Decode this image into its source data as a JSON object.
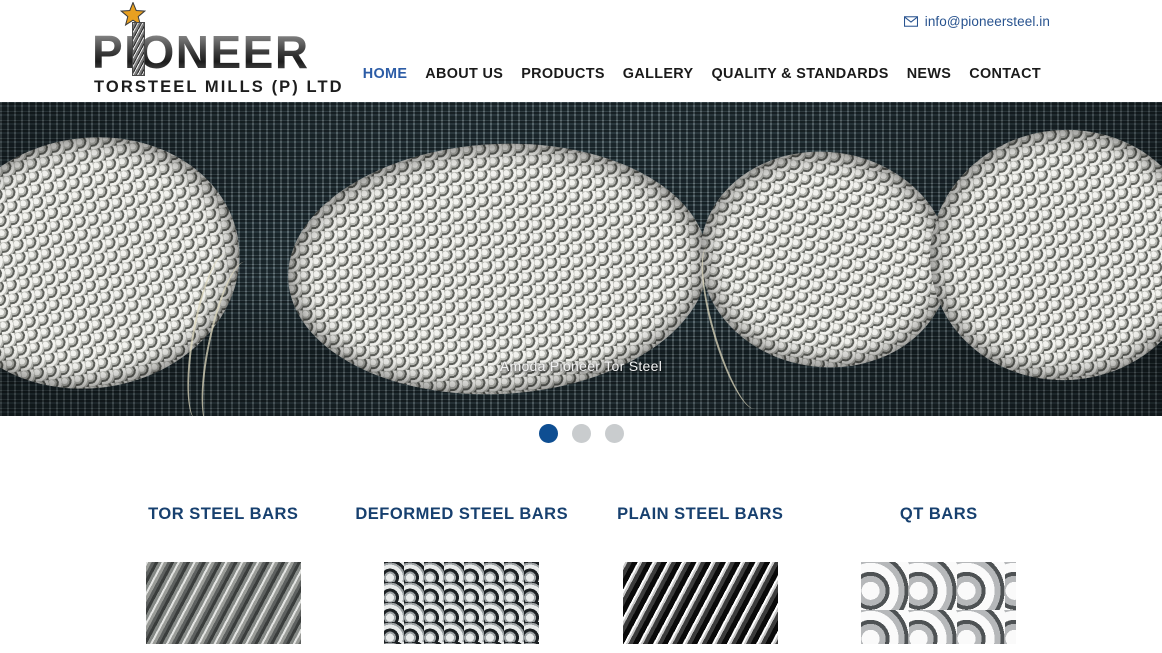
{
  "site": {
    "logo": {
      "word": "PIONEER",
      "subtitle": "TORSTEEL MILLS (P) LTD",
      "star_color": "#e8a020"
    },
    "contact": {
      "email": "info@pioneersteel.in",
      "email_color": "#28538f"
    }
  },
  "nav": {
    "items": [
      {
        "label": "HOME",
        "active": true
      },
      {
        "label": "ABOUT US",
        "active": false
      },
      {
        "label": "PRODUCTS",
        "active": false
      },
      {
        "label": "GALLERY",
        "active": false
      },
      {
        "label": "QUALITY & STANDARDS",
        "active": false
      },
      {
        "label": "NEWS",
        "active": false
      },
      {
        "label": "CONTACT",
        "active": false
      }
    ],
    "active_color": "#2c5ca6",
    "text_color": "#1a1a1a"
  },
  "hero": {
    "caption": "Amoda Pioneer Tor Steel",
    "alt": "bundles of tor steel rebar with bright cut ends"
  },
  "carousel": {
    "slides": [
      {
        "index": 1,
        "active": true
      },
      {
        "index": 2,
        "active": false
      },
      {
        "index": 3,
        "active": false
      }
    ],
    "active_dot_color": "#0e4e92",
    "inactive_dot_color": "#c9ccce"
  },
  "products": {
    "heading_color": "#17406f",
    "items": [
      {
        "title": "TOR STEEL BARS",
        "thumb_class": "thumb-tor"
      },
      {
        "title": "DEFORMED STEEL BARS",
        "thumb_class": "thumb-deformed"
      },
      {
        "title": "PLAIN STEEL BARS",
        "thumb_class": "thumb-plain"
      },
      {
        "title": "QT BARS",
        "thumb_class": "thumb-qt"
      }
    ]
  }
}
